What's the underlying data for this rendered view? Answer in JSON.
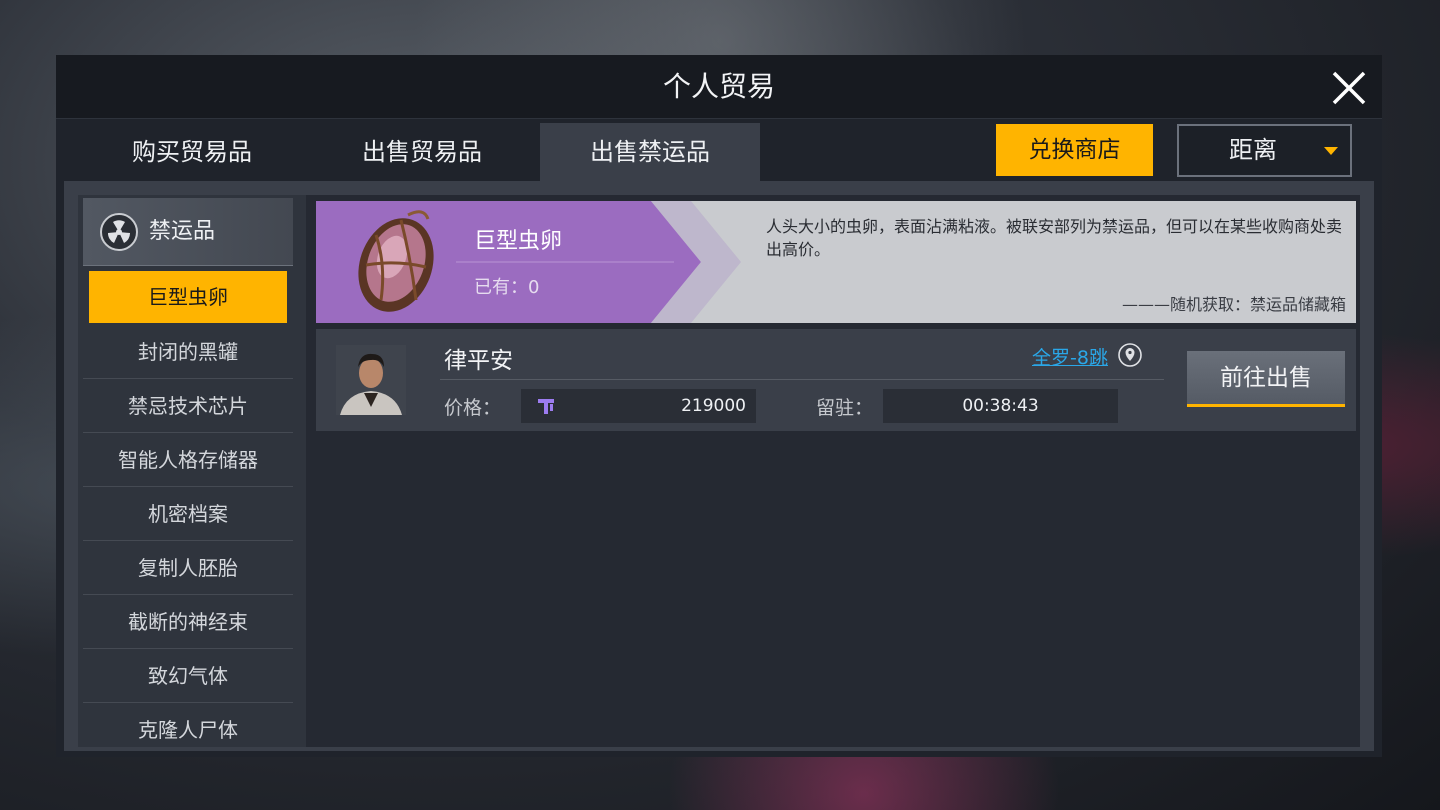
{
  "window": {
    "title": "个人贸易"
  },
  "tabs": [
    {
      "label": "购买贸易品"
    },
    {
      "label": "出售贸易品"
    },
    {
      "label": "出售禁运品",
      "active": true
    }
  ],
  "toolbar": {
    "exchange_label": "兑换商店",
    "sort_selected": "距离"
  },
  "sidebar": {
    "category_title": "禁运品",
    "category_icon": "radiation-icon",
    "items": [
      {
        "label": "巨型虫卵",
        "active": true
      },
      {
        "label": "封闭的黑罐"
      },
      {
        "label": "禁忌技术芯片"
      },
      {
        "label": "智能人格存储器"
      },
      {
        "label": "机密档案"
      },
      {
        "label": "复制人胚胎"
      },
      {
        "label": "截断的神经束"
      },
      {
        "label": "致幻气体"
      },
      {
        "label": "克隆人尸体"
      }
    ]
  },
  "item": {
    "name": "巨型虫卵",
    "owned": "已有：0",
    "description": "人头大小的虫卵，表面沾满粘液。被联安部列为禁运品，但可以在某些收购商处卖出高价。",
    "source": "———随机获取：禁运品储藏箱"
  },
  "listings": [
    {
      "seller": "律平安",
      "location": "全罗-8跳",
      "price_label": "价格：",
      "price": "219000",
      "stay_label": "留驻：",
      "stay_time": "00:38:43",
      "action_label": "前往出售"
    }
  ],
  "colors": {
    "accent": "#ffb400",
    "banner_purple": "#9b6cc0",
    "link": "#2aa7e8"
  }
}
